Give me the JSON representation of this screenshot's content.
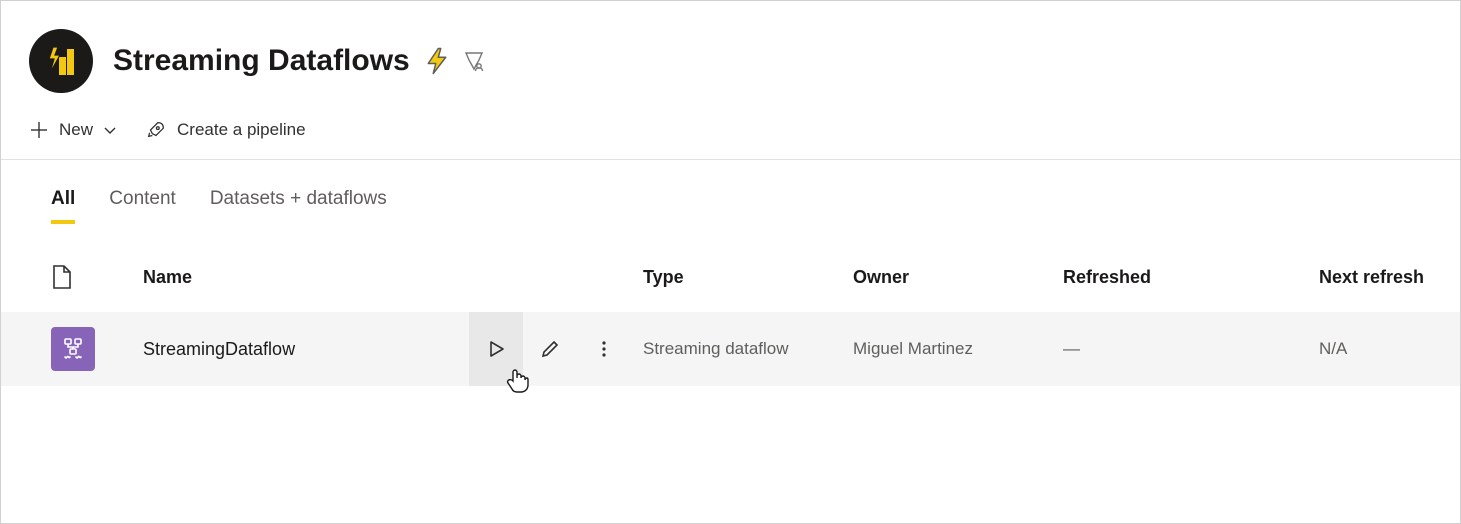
{
  "workspace": {
    "title": "Streaming Dataflows"
  },
  "toolbar": {
    "new_label": "New",
    "pipeline_label": "Create a pipeline"
  },
  "tabs": [
    {
      "label": "All",
      "active": true
    },
    {
      "label": "Content",
      "active": false
    },
    {
      "label": "Datasets + dataflows",
      "active": false
    }
  ],
  "columns": {
    "name": "Name",
    "type": "Type",
    "owner": "Owner",
    "refreshed": "Refreshed",
    "next_refresh": "Next refresh"
  },
  "rows": [
    {
      "name": "StreamingDataflow",
      "type": "Streaming dataflow",
      "owner": "Miguel Martinez",
      "refreshed": "—",
      "next_refresh": "N/A"
    }
  ]
}
